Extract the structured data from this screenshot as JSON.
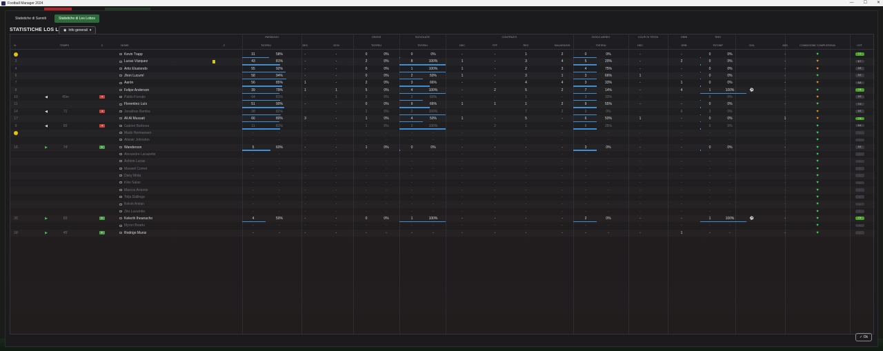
{
  "window": {
    "title": "Football Manager 2024",
    "controls": [
      "—",
      "☐",
      "✕"
    ]
  },
  "tabs": [
    "Statistiche di Sanniti",
    "Statistiche di Los Lobos"
  ],
  "active_tab": 1,
  "heading": "STATISTICHE LOS LOBOS",
  "dropdown_label": "Info generali",
  "groups": [
    "PASSAGGI",
    "CROSS",
    "SCIVOLATE",
    "CONTRASTI",
    "GIOCO AEREO",
    "COLPI DI TESTA",
    "DRIB",
    "TIRO"
  ],
  "columns": [
    "N.",
    "TEMPO",
    "C",
    "NOME",
    "C",
    "TNT/RIU",
    "DEC",
    "OCN",
    "TNT/RIU",
    "TNT/RIU",
    "DEC",
    "FFF",
    "REC",
    "SALVATAGGI",
    "TNT/RIU",
    "DEC",
    "DRB",
    "TNT/INP",
    "GOL",
    "ASS",
    "CONDIZIONE COMPLESSIVA",
    "VOT"
  ],
  "players": [
    {
      "num": "",
      "mood": true,
      "time": "",
      "sub": "",
      "name": "Kevin Trapp",
      "card": false,
      "pass_n": "31",
      "pass_p": "58%",
      "pass_dec": "-",
      "ocn": "-",
      "cross_n": "0",
      "cross_p": "0%",
      "tack_n": "0",
      "tack_p": "0%",
      "tk_dec": "-",
      "fff": "-",
      "rec": "1",
      "salv": "2",
      "air_n": "0",
      "air_p": "0%",
      "head_dec": "-",
      "drb": "-",
      "shot_n": "0",
      "shot_p": "0%",
      "gol": "",
      "ass": "-",
      "heart": "green",
      "vot": "7.2",
      "vg": true,
      "dim": false
    },
    {
      "num": "3",
      "mood": false,
      "time": "",
      "sub": "",
      "name": "Lucas Vázquez",
      "card": true,
      "pass_n": "43",
      "pass_p": "81%",
      "pass_dec": "-",
      "ocn": "-",
      "cross_n": "2",
      "cross_p": "0%",
      "tack_n": "8",
      "tack_p": "100%",
      "tk_dec": "1",
      "fff": "-",
      "rec": "3",
      "salv": "4",
      "air_n": "5",
      "air_p": "20%",
      "head_dec": "-",
      "drb": "2",
      "shot_n": "0",
      "shot_p": "0%",
      "gol": "",
      "ass": "-",
      "heart": "orange",
      "vot": "6.7",
      "vg": false,
      "dim": false
    },
    {
      "num": "4",
      "mood": false,
      "time": "",
      "sub": "",
      "name": "Aritz Elustondo",
      "card": false,
      "pass_n": "55",
      "pass_p": "92%",
      "pass_dec": "-",
      "ocn": "-",
      "cross_n": "0",
      "cross_p": "0%",
      "tack_n": "1",
      "tack_p": "100%",
      "tk_dec": "1",
      "fff": "-",
      "rec": "2",
      "salv": "3",
      "air_n": "4",
      "air_p": "75%",
      "head_dec": "-",
      "drb": "-",
      "shot_n": "0",
      "shot_p": "0%",
      "gol": "",
      "ass": "-",
      "heart": "orange",
      "vot": "6.8",
      "vg": false,
      "dim": false
    },
    {
      "num": "6",
      "mood": false,
      "time": "",
      "sub": "",
      "name": "Jhon Lucumí",
      "card": false,
      "pass_n": "58",
      "pass_p": "94%",
      "pass_dec": "-",
      "ocn": "-",
      "cross_n": "0",
      "cross_p": "0%",
      "tack_n": "2",
      "tack_p": "50%",
      "tk_dec": "1",
      "fff": "-",
      "rec": "3",
      "salv": "1",
      "air_n": "3",
      "air_p": "66%",
      "head_dec": "1",
      "drb": "-",
      "shot_n": "0",
      "shot_p": "0%",
      "gol": "",
      "ass": "-",
      "heart": "green",
      "vot": "6.9",
      "vg": false,
      "dim": false
    },
    {
      "num": "7",
      "mood": false,
      "time": "",
      "sub": "",
      "name": "Aarón",
      "card": false,
      "pass_n": "56",
      "pass_p": "85%",
      "pass_dec": "1",
      "ocn": "-",
      "cross_n": "2",
      "cross_p": "0%",
      "tack_n": "3",
      "tack_p": "66%",
      "tk_dec": "-",
      "fff": "-",
      "rec": "4",
      "salv": "4",
      "air_n": "3",
      "air_p": "33%",
      "head_dec": "-",
      "drb": "1",
      "shot_n": "0",
      "shot_p": "0%",
      "gol": "",
      "ass": "-",
      "heart": "orange",
      "vot": "6.8",
      "vg": false,
      "dim": false
    },
    {
      "num": "8",
      "mood": false,
      "time": "",
      "sub": "",
      "name": "Felipe Anderson",
      "card": false,
      "pass_n": "39",
      "pass_p": "79%",
      "pass_dec": "1",
      "ocn": "1",
      "cross_n": "5",
      "cross_p": "0%",
      "tack_n": "4",
      "tack_p": "100%",
      "tk_dec": "-",
      "fff": "2",
      "rec": "5",
      "salv": "2",
      "air_n": "7",
      "air_p": "14%",
      "head_dec": "-",
      "drb": "4",
      "shot_n": "1",
      "shot_p": "100%",
      "gol": "⚽",
      "ass": "-",
      "heart": "green",
      "vot": "7.8",
      "vg": true,
      "dim": false
    },
    {
      "num": "10",
      "mood": false,
      "time": "45m",
      "sub": "out",
      "name": "Pablo Fornals",
      "card": false,
      "pass_n": "64",
      "pass_p": "81%",
      "pass_dec": "-",
      "ocn": "1",
      "cross_n": "2",
      "cross_p": "0%",
      "tack_n": "2",
      "tack_p": "50%",
      "tk_dec": "-",
      "fff": "-",
      "rec": "1",
      "salv": "-",
      "air_n": "3",
      "air_p": "33%",
      "head_dec": "-",
      "drb": "-",
      "shot_n": "0",
      "shot_p": "0%",
      "gol": "",
      "ass": "-",
      "heart": "orange",
      "vot": "6.9",
      "vg": false,
      "dim": true
    },
    {
      "num": "11",
      "mood": false,
      "time": "",
      "sub": "",
      "name": "Florentino Luís",
      "card": false,
      "pass_n": "51",
      "pass_p": "90%",
      "pass_dec": "-",
      "ocn": "-",
      "cross_n": "0",
      "cross_p": "0%",
      "tack_n": "9",
      "tack_p": "66%",
      "tk_dec": "1",
      "fff": "1",
      "rec": "1",
      "salv": "2",
      "air_n": "9",
      "air_p": "55%",
      "head_dec": "-",
      "drb": "-",
      "shot_n": "0",
      "shot_p": "0%",
      "gol": "",
      "ass": "-",
      "heart": "green",
      "vot": "7.0",
      "vg": false,
      "dim": false
    },
    {
      "num": "14",
      "mood": false,
      "time": "71'",
      "sub": "out",
      "name": "Jonathan Bamba",
      "card": false,
      "pass_n": "28",
      "pass_p": "82%",
      "pass_dec": "-",
      "ocn": "-",
      "cross_n": "2",
      "cross_p": "0%",
      "tack_n": "2",
      "tack_p": "100%",
      "tk_dec": "-",
      "fff": "-",
      "rec": "7",
      "salv": "2",
      "air_n": "2",
      "air_p": "0%",
      "head_dec": "-",
      "drb": "6",
      "shot_n": "3",
      "shot_p": "0%",
      "gol": "",
      "ass": "-",
      "heart": "orange",
      "vot": "6.6",
      "vg": false,
      "dim": true
    },
    {
      "num": "17",
      "mood": false,
      "time": "",
      "sub": "",
      "name": "Ali Al Mussati",
      "card": false,
      "pass_n": "66",
      "pass_p": "80%",
      "pass_dec": "3",
      "ocn": "-",
      "cross_n": "1",
      "cross_p": "0%",
      "tack_n": "4",
      "tack_p": "50%",
      "tk_dec": "1",
      "fff": "-",
      "rec": "5",
      "salv": "-",
      "air_n": "6",
      "air_p": "50%",
      "head_dec": "1",
      "drb": "-",
      "shot_n": "0",
      "shot_p": "0%",
      "gol": "",
      "ass": "1",
      "heart": "orange",
      "vot": "7.5",
      "vg": true,
      "dim": false
    },
    {
      "num": "9",
      "mood": false,
      "time": "65'",
      "sub": "out",
      "name": "Gabriel Barbosa",
      "card": false,
      "pass_n": "11",
      "pass_p": "81%",
      "pass_dec": "-",
      "ocn": "-",
      "cross_n": "1",
      "cross_p": "0%",
      "tack_n": "2",
      "tack_p": "100%",
      "tk_dec": "-",
      "fff": "2",
      "rec": "1",
      "salv": "-",
      "air_n": "8",
      "air_p": "25%",
      "head_dec": "-",
      "drb": "-",
      "shot_n": "0",
      "shot_p": "0%",
      "gol": "",
      "ass": "-",
      "heart": "green",
      "vot": "6.4",
      "vg": false,
      "dim": true
    },
    {
      "num": "",
      "mood": true,
      "time": "",
      "sub": "",
      "name": "Mads Hermansen",
      "card": false,
      "pass_n": "-",
      "pass_p": "-",
      "pass_dec": "-",
      "ocn": "-",
      "cross_n": "-",
      "cross_p": "-",
      "tack_n": "-",
      "tack_p": "-",
      "tk_dec": "-",
      "fff": "-",
      "rec": "-",
      "salv": "-",
      "air_n": "-",
      "air_p": "-",
      "head_dec": "-",
      "drb": "-",
      "shot_n": "-",
      "shot_p": "-",
      "gol": "",
      "ass": "-",
      "heart": "green",
      "vot": "-",
      "vg": false,
      "dim": true
    },
    {
      "num": "",
      "mood": false,
      "time": "",
      "sub": "",
      "name": "Alistair Johnston",
      "card": false,
      "pass_n": "-",
      "pass_p": "-",
      "pass_dec": "-",
      "ocn": "-",
      "cross_n": "-",
      "cross_p": "-",
      "tack_n": "-",
      "tack_p": "-",
      "tk_dec": "-",
      "fff": "-",
      "rec": "-",
      "salv": "-",
      "air_n": "-",
      "air_p": "-",
      "head_dec": "-",
      "drb": "-",
      "shot_n": "-",
      "shot_p": "-",
      "gol": "",
      "ass": "-",
      "heart": "green",
      "vot": "-",
      "vg": false,
      "dim": true
    },
    {
      "num": "16",
      "mood": false,
      "time": "74'",
      "sub": "in",
      "name": "Wanderson",
      "card": false,
      "pass_n": "5",
      "pass_p": "60%",
      "pass_dec": "-",
      "ocn": "-",
      "cross_n": "1",
      "cross_p": "0%",
      "tack_n": "0",
      "tack_p": "0%",
      "tk_dec": "-",
      "fff": "-",
      "rec": "-",
      "salv": "-",
      "air_n": "3",
      "air_p": "0%",
      "head_dec": "-",
      "drb": "-",
      "shot_n": "0",
      "shot_p": "0%",
      "gol": "",
      "ass": "-",
      "heart": "green",
      "vot": "6.5",
      "vg": false,
      "dim": false
    },
    {
      "num": "",
      "mood": false,
      "time": "",
      "sub": "",
      "name": "Alexandre Lacazette",
      "card": false,
      "pass_n": "-",
      "pass_p": "-",
      "pass_dec": "-",
      "ocn": "-",
      "cross_n": "-",
      "cross_p": "-",
      "tack_n": "-",
      "tack_p": "-",
      "tk_dec": "-",
      "fff": "-",
      "rec": "-",
      "salv": "-",
      "air_n": "-",
      "air_p": "-",
      "head_dec": "-",
      "drb": "-",
      "shot_n": "-",
      "shot_p": "-",
      "gol": "",
      "ass": "-",
      "heart": "green",
      "vot": "-",
      "vg": false,
      "dim": true
    },
    {
      "num": "",
      "mood": false,
      "time": "",
      "sub": "",
      "name": "Ashton Lucas",
      "card": false,
      "pass_n": "-",
      "pass_p": "-",
      "pass_dec": "-",
      "ocn": "-",
      "cross_n": "-",
      "cross_p": "-",
      "tack_n": "-",
      "tack_p": "-",
      "tk_dec": "-",
      "fff": "-",
      "rec": "-",
      "salv": "-",
      "air_n": "-",
      "air_p": "-",
      "head_dec": "-",
      "drb": "-",
      "shot_n": "-",
      "shot_p": "-",
      "gol": "",
      "ass": "-",
      "heart": "green",
      "vot": "-",
      "vg": false,
      "dim": true
    },
    {
      "num": "",
      "mood": false,
      "time": "",
      "sub": "",
      "name": "Maxwel Cornet",
      "card": false,
      "pass_n": "-",
      "pass_p": "-",
      "pass_dec": "-",
      "ocn": "-",
      "cross_n": "-",
      "cross_p": "-",
      "tack_n": "-",
      "tack_p": "-",
      "tk_dec": "-",
      "fff": "-",
      "rec": "-",
      "salv": "-",
      "air_n": "-",
      "air_p": "-",
      "head_dec": "-",
      "drb": "-",
      "shot_n": "-",
      "shot_p": "-",
      "gol": "",
      "ass": "-",
      "heart": "green",
      "vot": "-",
      "vg": false,
      "dim": true
    },
    {
      "num": "",
      "mood": false,
      "time": "",
      "sub": "",
      "name": "Dany Mota",
      "card": false,
      "pass_n": "-",
      "pass_p": "-",
      "pass_dec": "-",
      "ocn": "-",
      "cross_n": "-",
      "cross_p": "-",
      "tack_n": "-",
      "tack_p": "-",
      "tk_dec": "-",
      "fff": "-",
      "rec": "-",
      "salv": "-",
      "air_n": "-",
      "air_p": "-",
      "head_dec": "-",
      "drb": "-",
      "shot_n": "-",
      "shot_p": "-",
      "gol": "",
      "ass": "-",
      "heart": "green",
      "vot": "-",
      "vg": false,
      "dim": true
    },
    {
      "num": "",
      "mood": false,
      "time": "",
      "sub": "",
      "name": "Kike Salas",
      "card": false,
      "pass_n": "-",
      "pass_p": "-",
      "pass_dec": "-",
      "ocn": "-",
      "cross_n": "-",
      "cross_p": "-",
      "tack_n": "-",
      "tack_p": "-",
      "tk_dec": "-",
      "fff": "-",
      "rec": "-",
      "salv": "-",
      "air_n": "-",
      "air_p": "-",
      "head_dec": "-",
      "drb": "-",
      "shot_n": "-",
      "shot_p": "-",
      "gol": "",
      "ass": "-",
      "heart": "green",
      "vot": "-",
      "vg": false,
      "dim": true
    },
    {
      "num": "",
      "mood": false,
      "time": "",
      "sub": "",
      "name": "Marcos Antonio",
      "card": false,
      "pass_n": "-",
      "pass_p": "-",
      "pass_dec": "-",
      "ocn": "-",
      "cross_n": "-",
      "cross_p": "-",
      "tack_n": "-",
      "tack_p": "-",
      "tk_dec": "-",
      "fff": "-",
      "rec": "-",
      "salv": "-",
      "air_n": "-",
      "air_p": "-",
      "head_dec": "-",
      "drb": "-",
      "shot_n": "-",
      "shot_p": "-",
      "gol": "",
      "ass": "-",
      "heart": "green",
      "vot": "-",
      "vg": false,
      "dim": true
    },
    {
      "num": "",
      "mood": false,
      "time": "",
      "sub": "",
      "name": "Tolja Dallinga",
      "card": false,
      "pass_n": "-",
      "pass_p": "-",
      "pass_dec": "-",
      "ocn": "-",
      "cross_n": "-",
      "cross_p": "-",
      "tack_n": "-",
      "tack_p": "-",
      "tk_dec": "-",
      "fff": "-",
      "rec": "-",
      "salv": "-",
      "air_n": "-",
      "air_p": "-",
      "head_dec": "-",
      "drb": "-",
      "shot_n": "-",
      "shot_p": "-",
      "gol": "",
      "ass": "-",
      "heart": "green",
      "vot": "-",
      "vg": false,
      "dim": true
    },
    {
      "num": "",
      "mood": false,
      "time": "",
      "sub": "",
      "name": "Kelvin Amian",
      "card": false,
      "pass_n": "-",
      "pass_p": "-",
      "pass_dec": "-",
      "ocn": "-",
      "cross_n": "-",
      "cross_p": "-",
      "tack_n": "-",
      "tack_p": "-",
      "tk_dec": "-",
      "fff": "-",
      "rec": "-",
      "salv": "-",
      "air_n": "-",
      "air_p": "-",
      "head_dec": "-",
      "drb": "-",
      "shot_n": "-",
      "shot_p": "-",
      "gol": "",
      "ass": "-",
      "heart": "green",
      "vot": "-",
      "vg": false,
      "dim": true
    },
    {
      "num": "",
      "mood": false,
      "time": "",
      "sub": "",
      "name": "Zito Luvumbo",
      "card": false,
      "pass_n": "-",
      "pass_p": "-",
      "pass_dec": "-",
      "ocn": "-",
      "cross_n": "-",
      "cross_p": "-",
      "tack_n": "-",
      "tack_p": "-",
      "tk_dec": "-",
      "fff": "-",
      "rec": "-",
      "salv": "-",
      "air_n": "-",
      "air_p": "-",
      "head_dec": "-",
      "drb": "-",
      "shot_n": "-",
      "shot_p": "-",
      "gol": "",
      "ass": "-",
      "heart": "green",
      "vot": "-",
      "vg": false,
      "dim": true
    },
    {
      "num": "20",
      "mood": false,
      "time": "65'",
      "sub": "in",
      "name": "Kelechi Iheanacho",
      "card": false,
      "pass_n": "4",
      "pass_p": "50%",
      "pass_dec": "-",
      "ocn": "-",
      "cross_n": "0",
      "cross_p": "0%",
      "tack_n": "1",
      "tack_p": "100%",
      "tk_dec": "-",
      "fff": "-",
      "rec": "-",
      "salv": "-",
      "air_n": "2",
      "air_p": "0%",
      "head_dec": "-",
      "drb": "-",
      "shot_n": "1",
      "shot_p": "100%",
      "gol": "⚽",
      "ass": "-",
      "heart": "green",
      "vot": "7.5",
      "vg": true,
      "dim": false
    },
    {
      "num": "",
      "mood": false,
      "time": "",
      "sub": "",
      "name": "Myron Boadu",
      "card": false,
      "pass_n": "-",
      "pass_p": "-",
      "pass_dec": "-",
      "ocn": "-",
      "cross_n": "-",
      "cross_p": "-",
      "tack_n": "-",
      "tack_p": "-",
      "tk_dec": "-",
      "fff": "-",
      "rec": "-",
      "salv": "-",
      "air_n": "-",
      "air_p": "-",
      "head_dec": "-",
      "drb": "-",
      "shot_n": "-",
      "shot_p": "-",
      "gol": "",
      "ass": "-",
      "heart": "green",
      "vot": "-",
      "vg": false,
      "dim": true
    },
    {
      "num": "18",
      "mood": false,
      "time": "45'",
      "sub": "in",
      "name": "Rodrigo Muniz",
      "card": false,
      "pass_n": "-",
      "pass_p": "-",
      "pass_dec": "-",
      "ocn": "-",
      "cross_n": "-",
      "cross_p": "-",
      "tack_n": "-",
      "tack_p": "-",
      "tk_dec": "-",
      "fff": "-",
      "rec": "-",
      "salv": "-",
      "air_n": "-",
      "air_p": "-",
      "head_dec": "-",
      "drb": "1",
      "shot_n": "-",
      "shot_p": "-",
      "gol": "",
      "ass": "-",
      "heart": "green",
      "vot": "-",
      "vg": false,
      "dim": false
    }
  ],
  "ok_label": "Ok",
  "colors": {
    "accent_green": "#2e6b3a",
    "bar_blue": "#3d8fd8",
    "sub_out_red": "#c9423e",
    "sub_in_green": "#4f9e4c",
    "heart_green": "#3dd15a",
    "heart_orange": "#e2922a"
  }
}
